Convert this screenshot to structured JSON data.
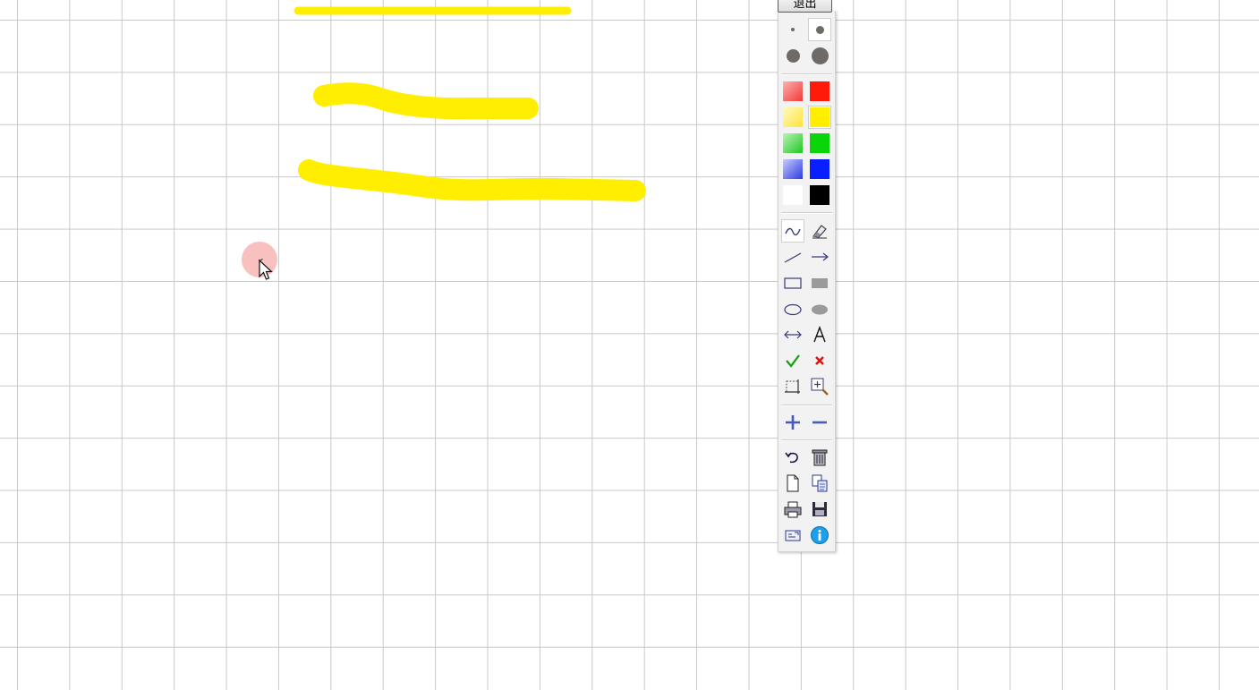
{
  "toolbar": {
    "exit_label": "退出",
    "pen_sizes": [
      "pen-size-xs",
      "pen-size-s",
      "pen-size-m",
      "pen-size-l"
    ],
    "colors": [
      {
        "name": "translucent-red",
        "value": "#ff6a6a"
      },
      {
        "name": "red",
        "value": "#ff1a0a"
      },
      {
        "name": "translucent-yellow",
        "value": "#fff070"
      },
      {
        "name": "yellow",
        "value": "#ffee00"
      },
      {
        "name": "translucent-green",
        "value": "#55dd55"
      },
      {
        "name": "green",
        "value": "#0ad40a"
      },
      {
        "name": "translucent-blue",
        "value": "#6670ee"
      },
      {
        "name": "blue",
        "value": "#0a1fff"
      },
      {
        "name": "white",
        "value": "#ffffff"
      },
      {
        "name": "black",
        "value": "#000000"
      }
    ],
    "selected_color": "yellow",
    "selected_tool": "freehand-pen",
    "tools": [
      "freehand-pen-icon",
      "eraser-icon",
      "line-icon",
      "arrow-icon",
      "rectangle-icon",
      "filled-rectangle-icon",
      "ellipse-icon",
      "filled-ellipse-icon",
      "double-arrow-icon",
      "text-icon",
      "check-icon",
      "cross-icon",
      "crop-select-icon",
      "zoom-icon",
      "plus-icon",
      "minus-icon",
      "undo-icon",
      "trash-icon",
      "new-page-icon",
      "copy-icon",
      "print-icon",
      "save-icon",
      "screen-capture-icon",
      "info-icon"
    ]
  },
  "canvas": {
    "background": "#ffffff",
    "grid_color": "#c9c9c9",
    "stroke_color": "#ffee00"
  }
}
